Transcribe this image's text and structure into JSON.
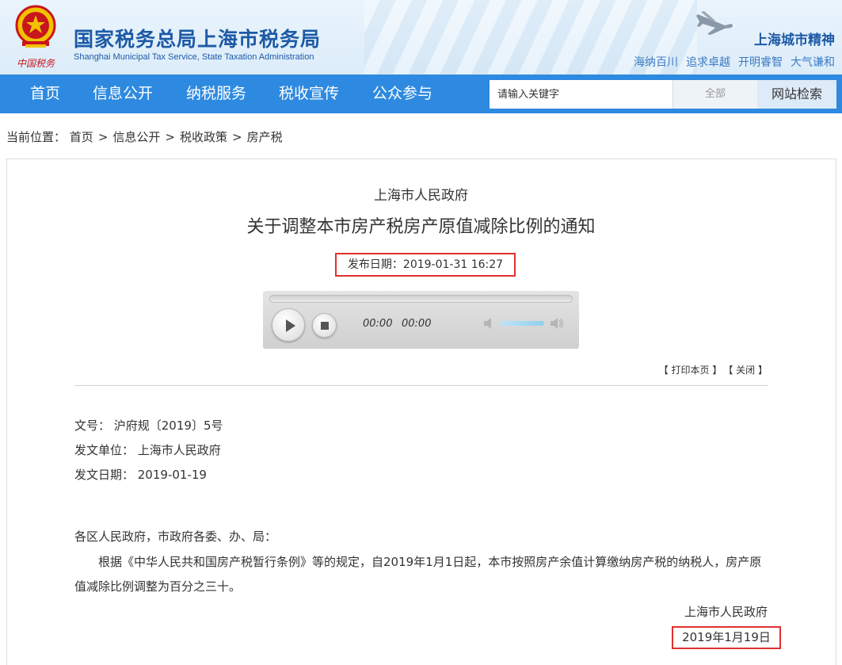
{
  "header": {
    "site_title": "国家税务总局上海市税务局",
    "site_subtitle": "Shanghai Municipal Tax Service, State Taxation Administration",
    "emblem_text": "中国税务",
    "city_spirit_title": "上海城市精神",
    "mottos": [
      "海纳百川",
      "追求卓越",
      "开明睿智",
      "大气谦和"
    ]
  },
  "nav": {
    "items": [
      "首页",
      "信息公开",
      "纳税服务",
      "税收宣传",
      "公众参与"
    ],
    "search_placeholder": "请输入关键字",
    "search_scope": "全部",
    "search_button": "网站检索"
  },
  "breadcrumb": {
    "prefix": "当前位置：",
    "items": [
      "首页",
      "信息公开",
      "税收政策",
      "房产税"
    ],
    "separator": ">"
  },
  "article": {
    "issuer": "上海市人民政府",
    "title": "关于调整本市房产税房产原值减除比例的通知",
    "publish_date": "发布日期：2019-01-31 16:27",
    "tools": {
      "print": "【 打印本页 】",
      "close": "【 关闭 】"
    },
    "meta": {
      "doc_no": "文号： 沪府规〔2019〕5号",
      "issuing_unit": "发文单位： 上海市人民政府",
      "issue_date": "发文日期： 2019-01-19"
    },
    "salutation": "各区人民政府，市政府各委、办、局：",
    "paragraph": "根据《中华人民共和国房产税暂行条例》等的规定，自2019年1月1日起，本市按照房产余值计算缴纳房产税的纳税人，房产原值减除比例调整为百分之三十。",
    "signature": "上海市人民政府",
    "sign_date": "2019年1月19日"
  },
  "player": {
    "current_time": "00:00",
    "duration": "00:00",
    "volume": 0.8
  },
  "colors": {
    "nav_bg": "#2e8ae0",
    "brand_blue": "#1d5aa6",
    "highlight_red": "#e03030"
  }
}
